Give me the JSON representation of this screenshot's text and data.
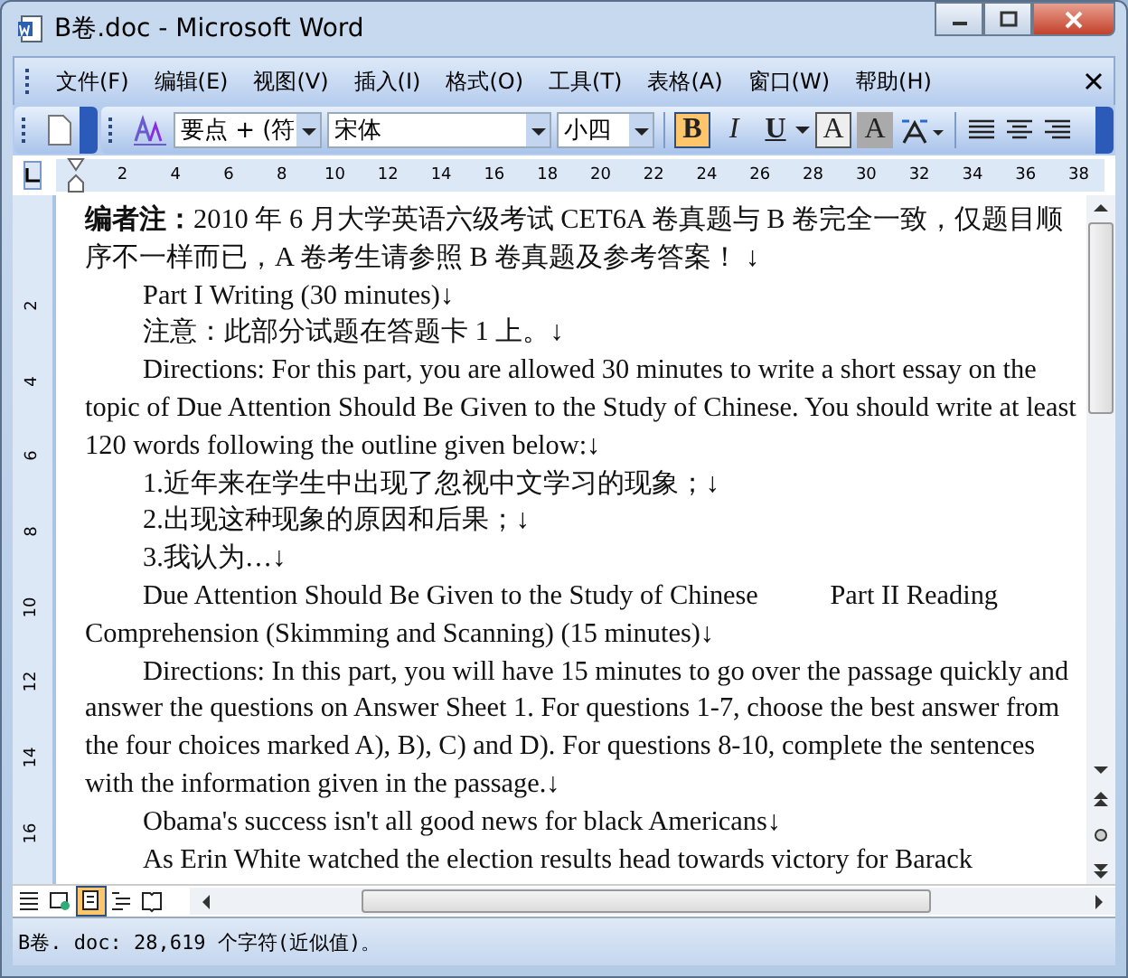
{
  "window": {
    "title": "B卷.doc - Microsoft Word"
  },
  "menu": [
    {
      "label": "文件(F)"
    },
    {
      "label": "编辑(E)"
    },
    {
      "label": "视图(V)"
    },
    {
      "label": "插入(I)"
    },
    {
      "label": "格式(O)"
    },
    {
      "label": "工具(T)"
    },
    {
      "label": "表格(A)"
    },
    {
      "label": "窗口(W)"
    },
    {
      "label": "帮助(H)"
    }
  ],
  "toolbar": {
    "style": "要点 + (符",
    "font": "宋体",
    "size": "小四",
    "format_buttons": [
      {
        "kind": "bold",
        "label": "B",
        "selected": true
      },
      {
        "kind": "italic",
        "label": "I",
        "selected": false
      },
      {
        "kind": "underline",
        "label": "U",
        "selected": false
      },
      {
        "kind": "border",
        "label": "A",
        "selected": false
      },
      {
        "kind": "shade",
        "label": "A",
        "selected": false
      }
    ]
  },
  "ruler": {
    "ticks": [
      "2",
      "4",
      "6",
      "8",
      "10",
      "12",
      "14",
      "16",
      "18",
      "20",
      "22",
      "24",
      "26",
      "28",
      "30",
      "32",
      "34",
      "36",
      "38"
    ],
    "vertical_ticks": [
      "2",
      "4",
      "6",
      "8",
      "10",
      "12",
      "14",
      "16"
    ]
  },
  "document": [
    {
      "text": "**编者注：**2010 年 6 月大学英语六级考试 CET6A 卷真题与 B 卷完全一致，仅题目顺序不一样而已，A 卷考生请参照 B 卷真题及参考答案！ ↓",
      "indent": false
    },
    {
      "text": "Part I Writing (30 minutes)↓",
      "indent": true
    },
    {
      "text": "注意：此部分试题在答题卡 1 上。↓",
      "indent": true
    },
    {
      "text": "Directions: For this part, you are allowed 30 minutes to write a short essay on the topic of Due Attention Should Be Given to the Study of Chinese. You should write at least 120 words following the outline given below:↓",
      "indent": true
    },
    {
      "text": "1.近年来在学生中出现了忽视中文学习的现象；↓",
      "indent": true
    },
    {
      "text": "2.出现这种现象的原因和后果；↓",
      "indent": true
    },
    {
      "text": "3.我认为…↓",
      "indent": true
    },
    {
      "text": "Due Attention Should Be Given to the Study of Chinese",
      "trailing": "Part II Reading Comprehension (Skimming and Scanning) (15 minutes)↓",
      "indent": true
    },
    {
      "text": "Directions: In this part, you will have 15 minutes to go over the passage quickly and answer the questions on Answer Sheet 1. For questions 1-7, choose the best answer from the four choices marked A), B), C) and D). For questions 8-10, complete the sentences with the information given in the passage.↓",
      "indent": true
    },
    {
      "text": "Obama's success isn't all good news for black Americans↓",
      "indent": true
    },
    {
      "text": "As Erin White watched the election results head towards victory for Barack",
      "indent": true
    }
  ],
  "views": [
    {
      "selected": false
    },
    {
      "selected": false
    },
    {
      "selected": true
    },
    {
      "selected": false
    },
    {
      "selected": false
    }
  ],
  "status_bar": "B卷. doc: 28,619 个字符(近似值)。"
}
